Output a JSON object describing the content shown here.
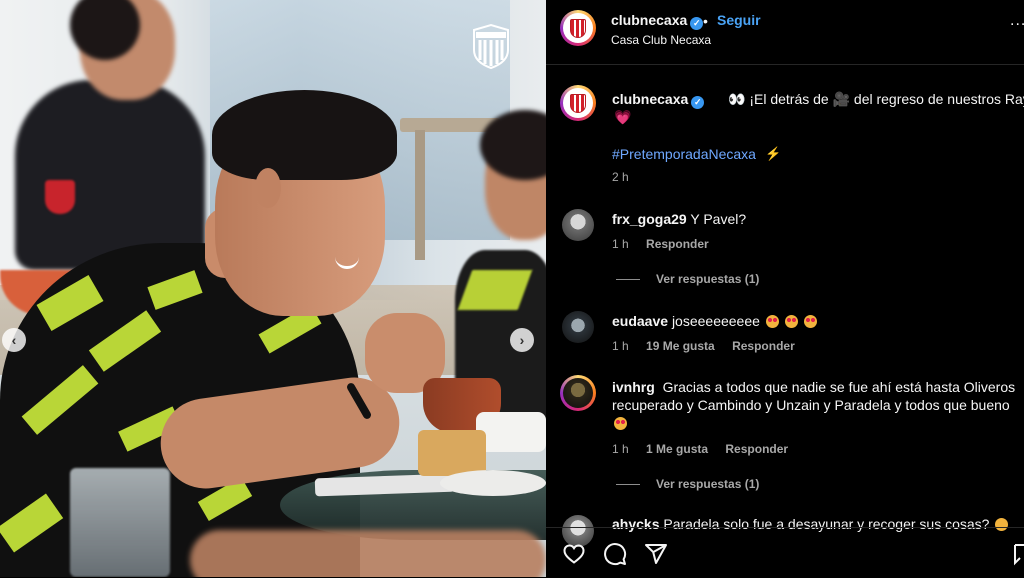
{
  "header": {
    "username": "clubnecaxa",
    "verified_mark": "✓",
    "separator": "•",
    "follow_label": "Seguir",
    "location": "Casa Club Necaxa",
    "more_label": "..."
  },
  "caption": {
    "username": "clubnecaxa",
    "text": "👀 ¡El detrás de 🎥 del regreso de nuestros Rayos!",
    "heart": "💗",
    "hashtag": "#PretemporadaNecaxa",
    "spark": "⚡",
    "time": "2 h"
  },
  "comments": [
    {
      "username": "frx_goga29",
      "text": "Y Pavel?",
      "time": "1 h",
      "likes": "",
      "reply_label": "Responder",
      "view_replies": "Ver respuestas (1)"
    },
    {
      "username": "eudaave",
      "text": "joseeeeeeeee",
      "time": "1 h",
      "likes": "19 Me gusta",
      "reply_label": "Responder",
      "view_replies": ""
    },
    {
      "username": "ivnhrg",
      "text": "Gracias a todos que nadie se fue ahí está hasta Oliveros recuperado y Cambindo y Unzain y Paradela y todos que bueno",
      "time": "1 h",
      "likes": "1 Me gusta",
      "reply_label": "Responder",
      "view_replies": "Ver respuestas (1)"
    },
    {
      "username": "ahycks",
      "text": "Paradela solo fue a desayunar y recoger sus cosas?",
      "time": "",
      "likes": "",
      "reply_label": "",
      "view_replies": ""
    }
  ],
  "icons": {
    "like": "heart-icon",
    "comment": "comment-icon",
    "share": "send-icon",
    "save": "bookmark-icon",
    "prev": "chevron-left-icon",
    "next": "chevron-right-icon"
  },
  "nav": {
    "prev": "‹",
    "next": "›"
  },
  "colors": {
    "link": "#6fa8ff",
    "follow": "#4aa3f5",
    "verified": "#3897f0",
    "neon": "#c3e23a"
  }
}
